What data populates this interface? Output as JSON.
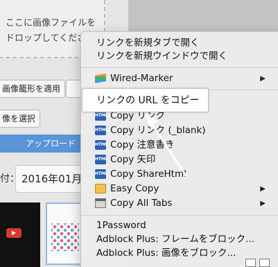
{
  "background": {
    "drop_text_line1": "ここに画像ファイルを",
    "drop_text_line2": "ドロップしてくださ",
    "apply_button": "画像籠形を適用",
    "select_button": "像を選択",
    "upload_button": "アップロード",
    "date_label": "付：",
    "date_value": "2016年01月"
  },
  "menu": {
    "open_new_tab": "リンクを新規タブで開く",
    "open_new_window": "リンクを新規ウインドウで開く",
    "wired_marker": "Wired-Marker",
    "copy_url": "リンクの URL をコピー",
    "copy_link": "Copy リンク",
    "copy_link_blank": "Copy リンク (_blank)",
    "copy_notice": "Copy 注意書き",
    "copy_arrow": "Copy 矢印",
    "copy_sharehtml": "Copy ShareHtml",
    "easy_copy": "Easy Copy",
    "copy_all_tabs": "Copy All Tabs",
    "onepassword": "1Password",
    "adblock_frame": "Adblock Plus: フレームをブロック...",
    "adblock_image": "Adblock Plus: 画像をブロック...",
    "html_badge": "HTML",
    "submenu_arrow": "▶"
  },
  "colors": {
    "menu_bg": "#ececec",
    "accent_blue": "#5a95d8",
    "html_icon": "#2b62b3"
  }
}
